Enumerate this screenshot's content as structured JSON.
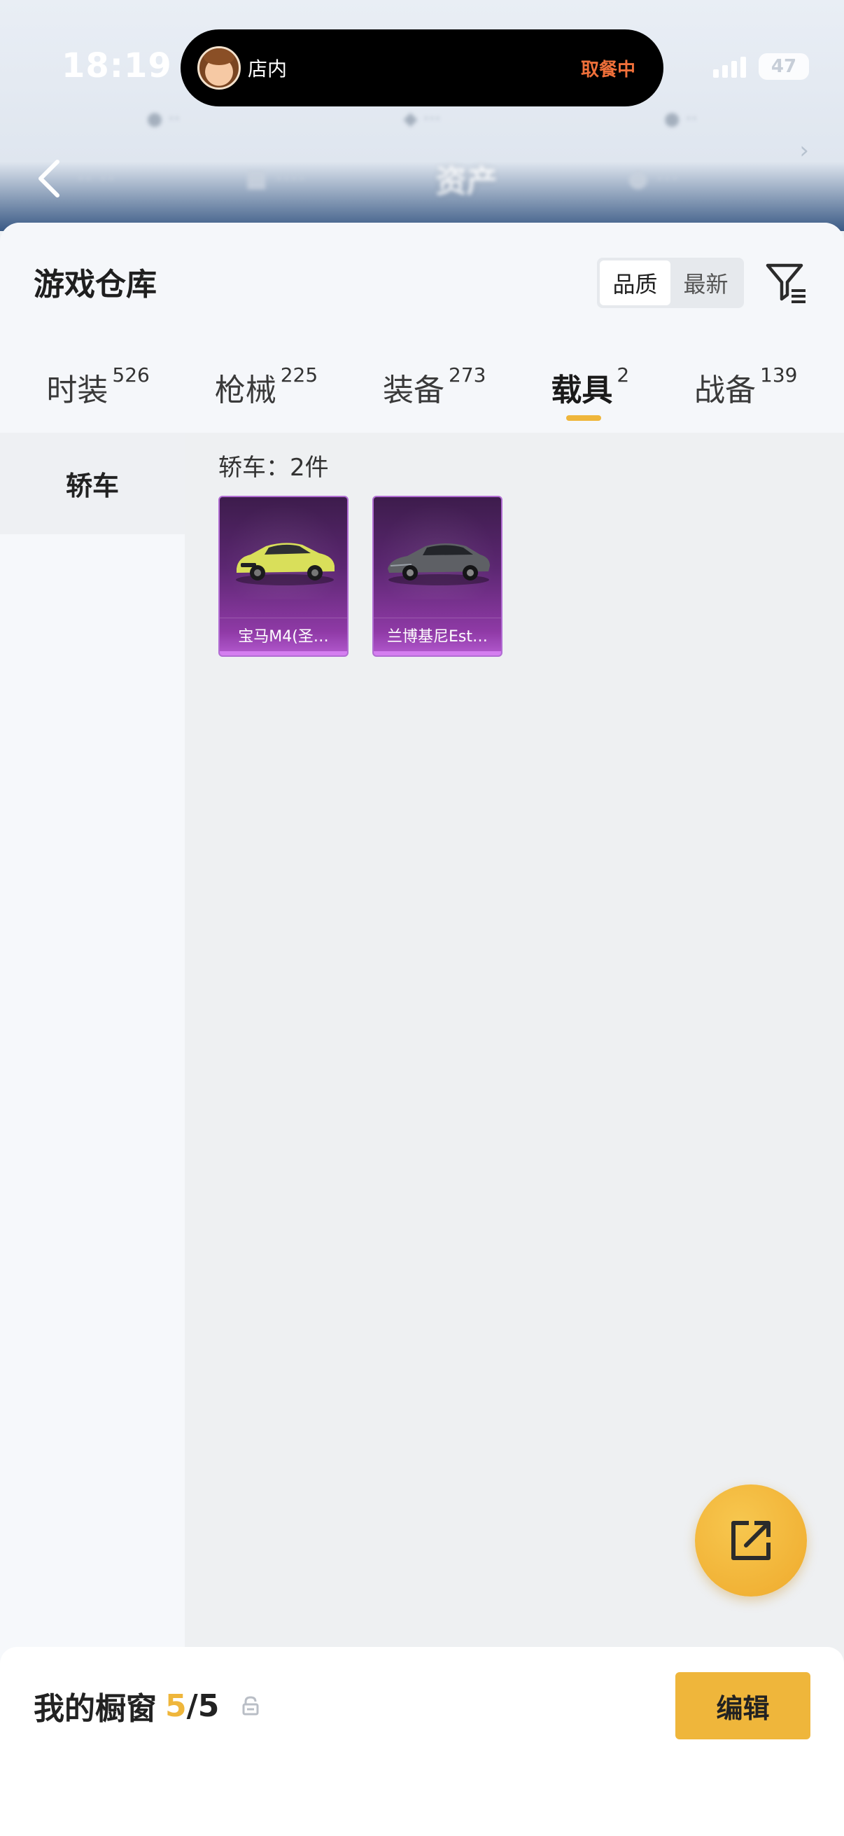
{
  "status_bar": {
    "time": "18:19",
    "battery": "47",
    "icons": [
      "signal-icon",
      "battery-icon"
    ]
  },
  "live_activity": {
    "label": "店内",
    "status": "取餐中",
    "status_color": "#f0703a"
  },
  "background_header": {
    "title": "资产",
    "icons": [
      "back-chevron-icon",
      "chevron-right-icon"
    ]
  },
  "warehouse": {
    "title": "游戏仓库",
    "sort_options": [
      {
        "label": "品质",
        "active": true
      },
      {
        "label": "最新",
        "active": false
      }
    ],
    "filter_icon": "filter-icon"
  },
  "tabs": [
    {
      "label": "时装",
      "count": "526",
      "active": false
    },
    {
      "label": "枪械",
      "count": "225",
      "active": false
    },
    {
      "label": "装备",
      "count": "273",
      "active": false
    },
    {
      "label": "载具",
      "count": "2",
      "active": true
    },
    {
      "label": "战备",
      "count": "139",
      "active": false
    }
  ],
  "accent_color": "#efb63b",
  "rail": {
    "items": [
      {
        "label": "轿车",
        "active": true
      }
    ]
  },
  "content": {
    "heading": "轿车：2件",
    "items": [
      {
        "name": "宝马M4(圣…",
        "color": "#d9df5a",
        "rarity_color": "#b45ad0"
      },
      {
        "name": "兰博基尼Est…",
        "color": "#5e6065",
        "rarity_color": "#b45ad0"
      }
    ]
  },
  "fab": {
    "icon": "share-icon"
  },
  "showcase": {
    "label": "我的橱窗",
    "used": "5",
    "total": "/5",
    "lock_icon": "lock-icon",
    "edit_label": "编辑"
  }
}
